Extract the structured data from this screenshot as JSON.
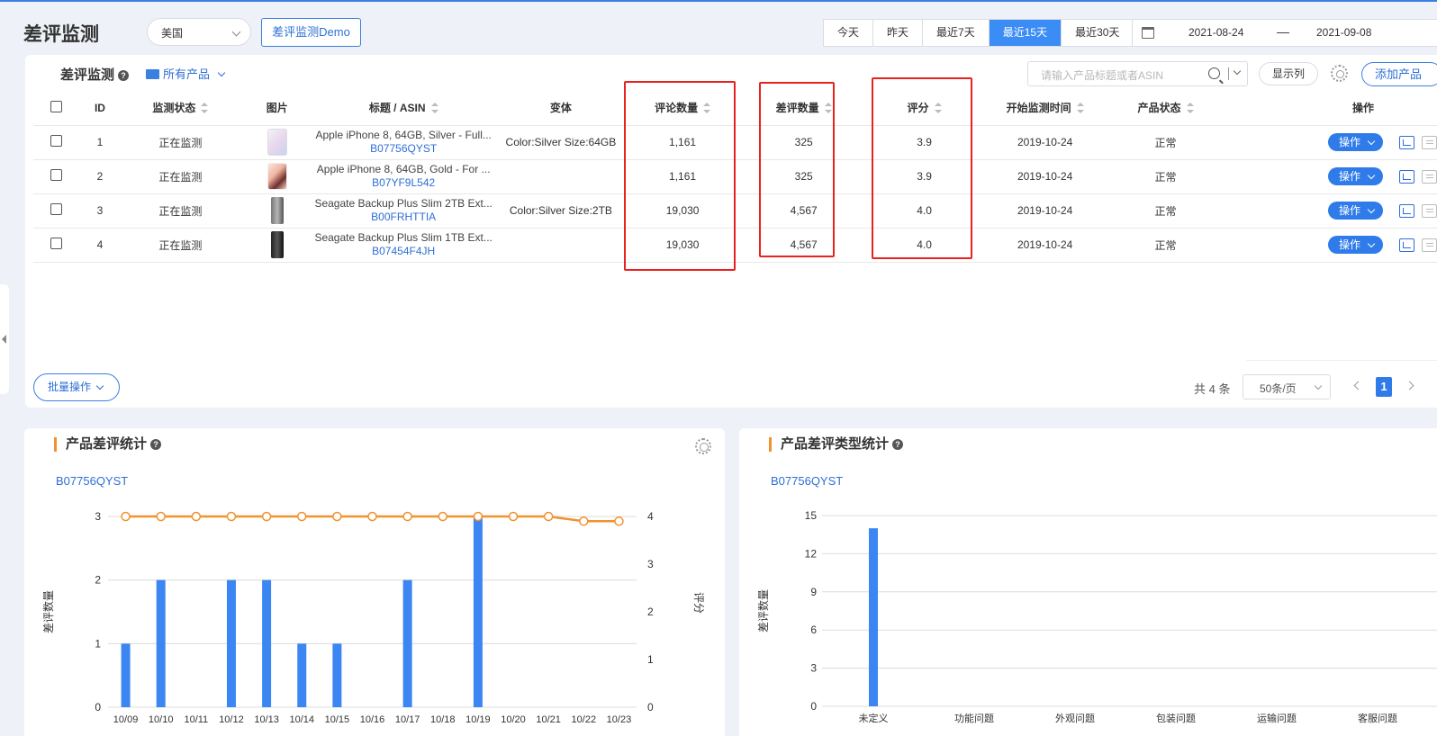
{
  "page": {
    "title": "差评监测",
    "country": "美国",
    "demo_button": "差评监测Demo"
  },
  "date_filter": {
    "options": [
      "今天",
      "昨天",
      "最近7天",
      "最近15天",
      "最近30天"
    ],
    "active": "最近15天",
    "start": "2021-08-24",
    "separator": "—",
    "end": "2021-09-08"
  },
  "monitor_card": {
    "title": "差评监测",
    "help": "?",
    "product_filter": "所有产品",
    "search_placeholder": "请输入产品标题或者ASIN",
    "show_columns": "显示列",
    "add_product": "添加产品",
    "columns": {
      "id": "ID",
      "status": "监测状态",
      "image": "图片",
      "title": "标题 / ASIN",
      "variant": "变体",
      "reviews": "评论数量",
      "negative": "差评数量",
      "rating": "评分",
      "start_time": "开始监测时间",
      "product_status": "产品状态",
      "actions": "操作"
    },
    "rows": [
      {
        "id": "1",
        "status": "正在监测",
        "image": "iphone-silver",
        "title": "Apple iPhone 8, 64GB, Silver - Full...",
        "asin": "B07756QYST",
        "variant": "Color:Silver Size:64GB",
        "reviews": "1,161",
        "negative": "325",
        "rating": "3.9",
        "start_time": "2019-10-24",
        "product_status": "正常",
        "action": "操作"
      },
      {
        "id": "2",
        "status": "正在监测",
        "image": "iphone-gold",
        "title": "Apple iPhone 8, 64GB, Gold - For ...",
        "asin": "B07YF9L542",
        "variant": "",
        "reviews": "1,161",
        "negative": "325",
        "rating": "3.9",
        "start_time": "2019-10-24",
        "product_status": "正常",
        "action": "操作"
      },
      {
        "id": "3",
        "status": "正在监测",
        "image": "drive-gray",
        "title": "Seagate Backup Plus Slim 2TB Ext...",
        "asin": "B00FRHTTIA",
        "variant": "Color:Silver Size:2TB",
        "reviews": "19,030",
        "negative": "4,567",
        "rating": "4.0",
        "start_time": "2019-10-24",
        "product_status": "正常",
        "action": "操作"
      },
      {
        "id": "4",
        "status": "正在监测",
        "image": "drive-black",
        "title": "Seagate Backup Plus Slim 1TB Ext...",
        "asin": "B07454F4JH",
        "variant": "",
        "reviews": "19,030",
        "negative": "4,567",
        "rating": "4.0",
        "start_time": "2019-10-24",
        "product_status": "正常",
        "action": "操作"
      }
    ],
    "batch": "批量操作",
    "total": "共 4 条",
    "page_size": "50条/页",
    "current_page": "1"
  },
  "stats_card": {
    "title": "产品差评统计",
    "asin": "B07756QYST"
  },
  "type_card": {
    "title": "产品差评类型统计",
    "asin": "B07756QYST"
  },
  "colors": {
    "accent": "#2f7bea",
    "bar": "#3b86f2",
    "line": "#f0922e",
    "highlight": "#e8231f"
  },
  "chart_data": [
    {
      "type": "bar",
      "categories": [
        "10/09",
        "10/10",
        "10/11",
        "10/12",
        "10/13",
        "10/14",
        "10/15",
        "10/16",
        "10/17",
        "10/18",
        "10/19",
        "10/20",
        "10/21",
        "10/22",
        "10/23"
      ],
      "series": [
        {
          "name": "差评数量",
          "type": "bar",
          "axis": "left",
          "values": [
            1,
            2,
            0,
            2,
            2,
            1,
            1,
            0,
            2,
            0,
            3,
            0,
            0,
            0,
            0
          ]
        },
        {
          "name": "评分",
          "type": "line",
          "axis": "right",
          "values": [
            4,
            4,
            4,
            4,
            4,
            4,
            4,
            4,
            4,
            4,
            4,
            4,
            4,
            3.9,
            3.9
          ]
        }
      ],
      "ylabel": "差评数量",
      "y2label": "评分",
      "ylim": [
        0,
        3
      ],
      "y2lim": [
        0,
        4
      ],
      "yticks": [
        0,
        1,
        2,
        3
      ],
      "y2ticks": [
        0,
        1,
        2,
        3,
        4
      ],
      "grid": true
    },
    {
      "type": "bar",
      "categories": [
        "未定义",
        "功能问题",
        "外观问题",
        "包装问题",
        "运输问题",
        "客服问题"
      ],
      "series": [
        {
          "name": "差评数量",
          "values": [
            14,
            0,
            0,
            0,
            0,
            0
          ]
        }
      ],
      "ylabel": "差评数量",
      "ylim": [
        0,
        15
      ],
      "yticks": [
        0,
        3,
        6,
        9,
        12,
        15
      ],
      "grid": true
    }
  ]
}
